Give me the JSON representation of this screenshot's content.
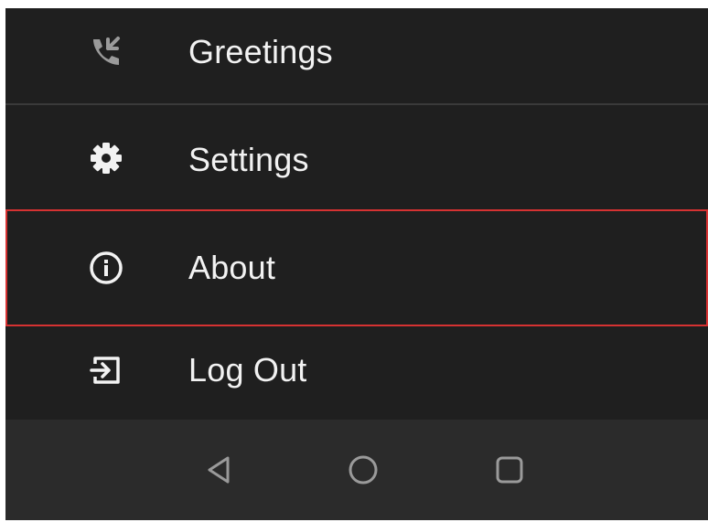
{
  "menu": {
    "items": [
      {
        "label": "Greetings",
        "icon": "voicemail-phone-icon",
        "selected": false
      },
      {
        "label": "Settings",
        "icon": "gear-icon",
        "selected": false
      },
      {
        "label": "About",
        "icon": "info-circle-icon",
        "selected": true
      },
      {
        "label": "Log Out",
        "icon": "logout-icon",
        "selected": false
      }
    ]
  },
  "navbar": {
    "buttons": [
      {
        "icon": "back-triangle-icon"
      },
      {
        "icon": "home-circle-icon"
      },
      {
        "icon": "recents-square-icon"
      }
    ]
  },
  "colors": {
    "background": "#1f1f1f",
    "navbar": "#2b2b2b",
    "text": "#f2f2f2",
    "selection_border": "#d63232",
    "divider": "#3a3a3a",
    "muted_icon": "#9a9a9a"
  }
}
